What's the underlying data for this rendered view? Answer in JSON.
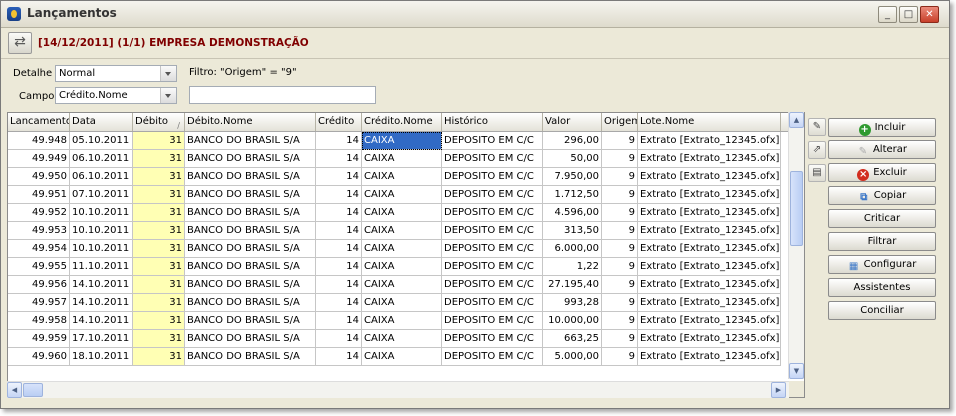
{
  "window": {
    "title": "Lançamentos"
  },
  "header": {
    "company_text": "[14/12/2011] (1/1) EMPRESA DEMONSTRAÇÃO"
  },
  "filters": {
    "detalhe_label": "Detalhe",
    "detalhe_value": "Normal",
    "filtro_text": "Filtro: \"Origem\" = \"9\"",
    "campo_label": "Campo",
    "campo_value": "Crédito.Nome",
    "search_value": ""
  },
  "grid": {
    "columns": [
      "Lancamento",
      "Data",
      "Débito",
      "Débito.Nome",
      "Crédito",
      "Crédito.Nome",
      "Histórico",
      "Valor",
      "Origem",
      "Lote.Nome"
    ],
    "rows": [
      [
        "49.948",
        "05.10.2011",
        "31",
        "BANCO DO BRASIL S/A",
        "14",
        "CAIXA",
        "DEPOSITO EM C/C",
        "296,00",
        "9",
        "Extrato [Extrato_12345.ofx]"
      ],
      [
        "49.949",
        "06.10.2011",
        "31",
        "BANCO DO BRASIL S/A",
        "14",
        "CAIXA",
        "DEPOSITO EM C/C",
        "50,00",
        "9",
        "Extrato [Extrato_12345.ofx]"
      ],
      [
        "49.950",
        "06.10.2011",
        "31",
        "BANCO DO BRASIL S/A",
        "14",
        "CAIXA",
        "DEPOSITO EM C/C",
        "7.950,00",
        "9",
        "Extrato [Extrato_12345.ofx]"
      ],
      [
        "49.951",
        "07.10.2011",
        "31",
        "BANCO DO BRASIL S/A",
        "14",
        "CAIXA",
        "DEPOSITO EM C/C",
        "1.712,50",
        "9",
        "Extrato [Extrato_12345.ofx]"
      ],
      [
        "49.952",
        "10.10.2011",
        "31",
        "BANCO DO BRASIL S/A",
        "14",
        "CAIXA",
        "DEPOSITO EM C/C",
        "4.596,00",
        "9",
        "Extrato [Extrato_12345.ofx]"
      ],
      [
        "49.953",
        "10.10.2011",
        "31",
        "BANCO DO BRASIL S/A",
        "14",
        "CAIXA",
        "DEPOSITO EM C/C",
        "313,50",
        "9",
        "Extrato [Extrato_12345.ofx]"
      ],
      [
        "49.954",
        "10.10.2011",
        "31",
        "BANCO DO BRASIL S/A",
        "14",
        "CAIXA",
        "DEPOSITO EM C/C",
        "6.000,00",
        "9",
        "Extrato [Extrato_12345.ofx]"
      ],
      [
        "49.955",
        "11.10.2011",
        "31",
        "BANCO DO BRASIL S/A",
        "14",
        "CAIXA",
        "DEPOSITO EM C/C",
        "1,22",
        "9",
        "Extrato [Extrato_12345.ofx]"
      ],
      [
        "49.956",
        "14.10.2011",
        "31",
        "BANCO DO BRASIL S/A",
        "14",
        "CAIXA",
        "DEPOSITO EM C/C",
        "27.195,40",
        "9",
        "Extrato [Extrato_12345.ofx]"
      ],
      [
        "49.957",
        "14.10.2011",
        "31",
        "BANCO DO BRASIL S/A",
        "14",
        "CAIXA",
        "DEPOSITO EM C/C",
        "993,28",
        "9",
        "Extrato [Extrato_12345.ofx]"
      ],
      [
        "49.958",
        "14.10.2011",
        "31",
        "BANCO DO BRASIL S/A",
        "14",
        "CAIXA",
        "DEPOSITO EM C/C",
        "10.000,00",
        "9",
        "Extrato [Extrato_12345.ofx]"
      ],
      [
        "49.959",
        "17.10.2011",
        "31",
        "BANCO DO BRASIL S/A",
        "14",
        "CAIXA",
        "DEPOSITO EM C/C",
        "663,25",
        "9",
        "Extrato [Extrato_12345.ofx]"
      ],
      [
        "49.960",
        "18.10.2011",
        "31",
        "BANCO DO BRASIL S/A",
        "14",
        "CAIXA",
        "DEPOSITO EM C/C",
        "5.000,00",
        "9",
        "Extrato [Extrato_12345.ofx]"
      ]
    ]
  },
  "side_tools": [
    "wrench-icon",
    "export-icon",
    "print-icon"
  ],
  "buttons": {
    "incluir": "Incluir",
    "alterar": "Alterar",
    "excluir": "Excluir",
    "copiar": "Copiar",
    "criticar": "Criticar",
    "filtrar": "Filtrar",
    "configurar": "Configurar",
    "assistentes": "Assistentes",
    "conciliar": "Conciliar"
  },
  "colors": {
    "company_text": "#800000",
    "highlight_column": "#ffffb4",
    "selection": "#316ac5"
  }
}
